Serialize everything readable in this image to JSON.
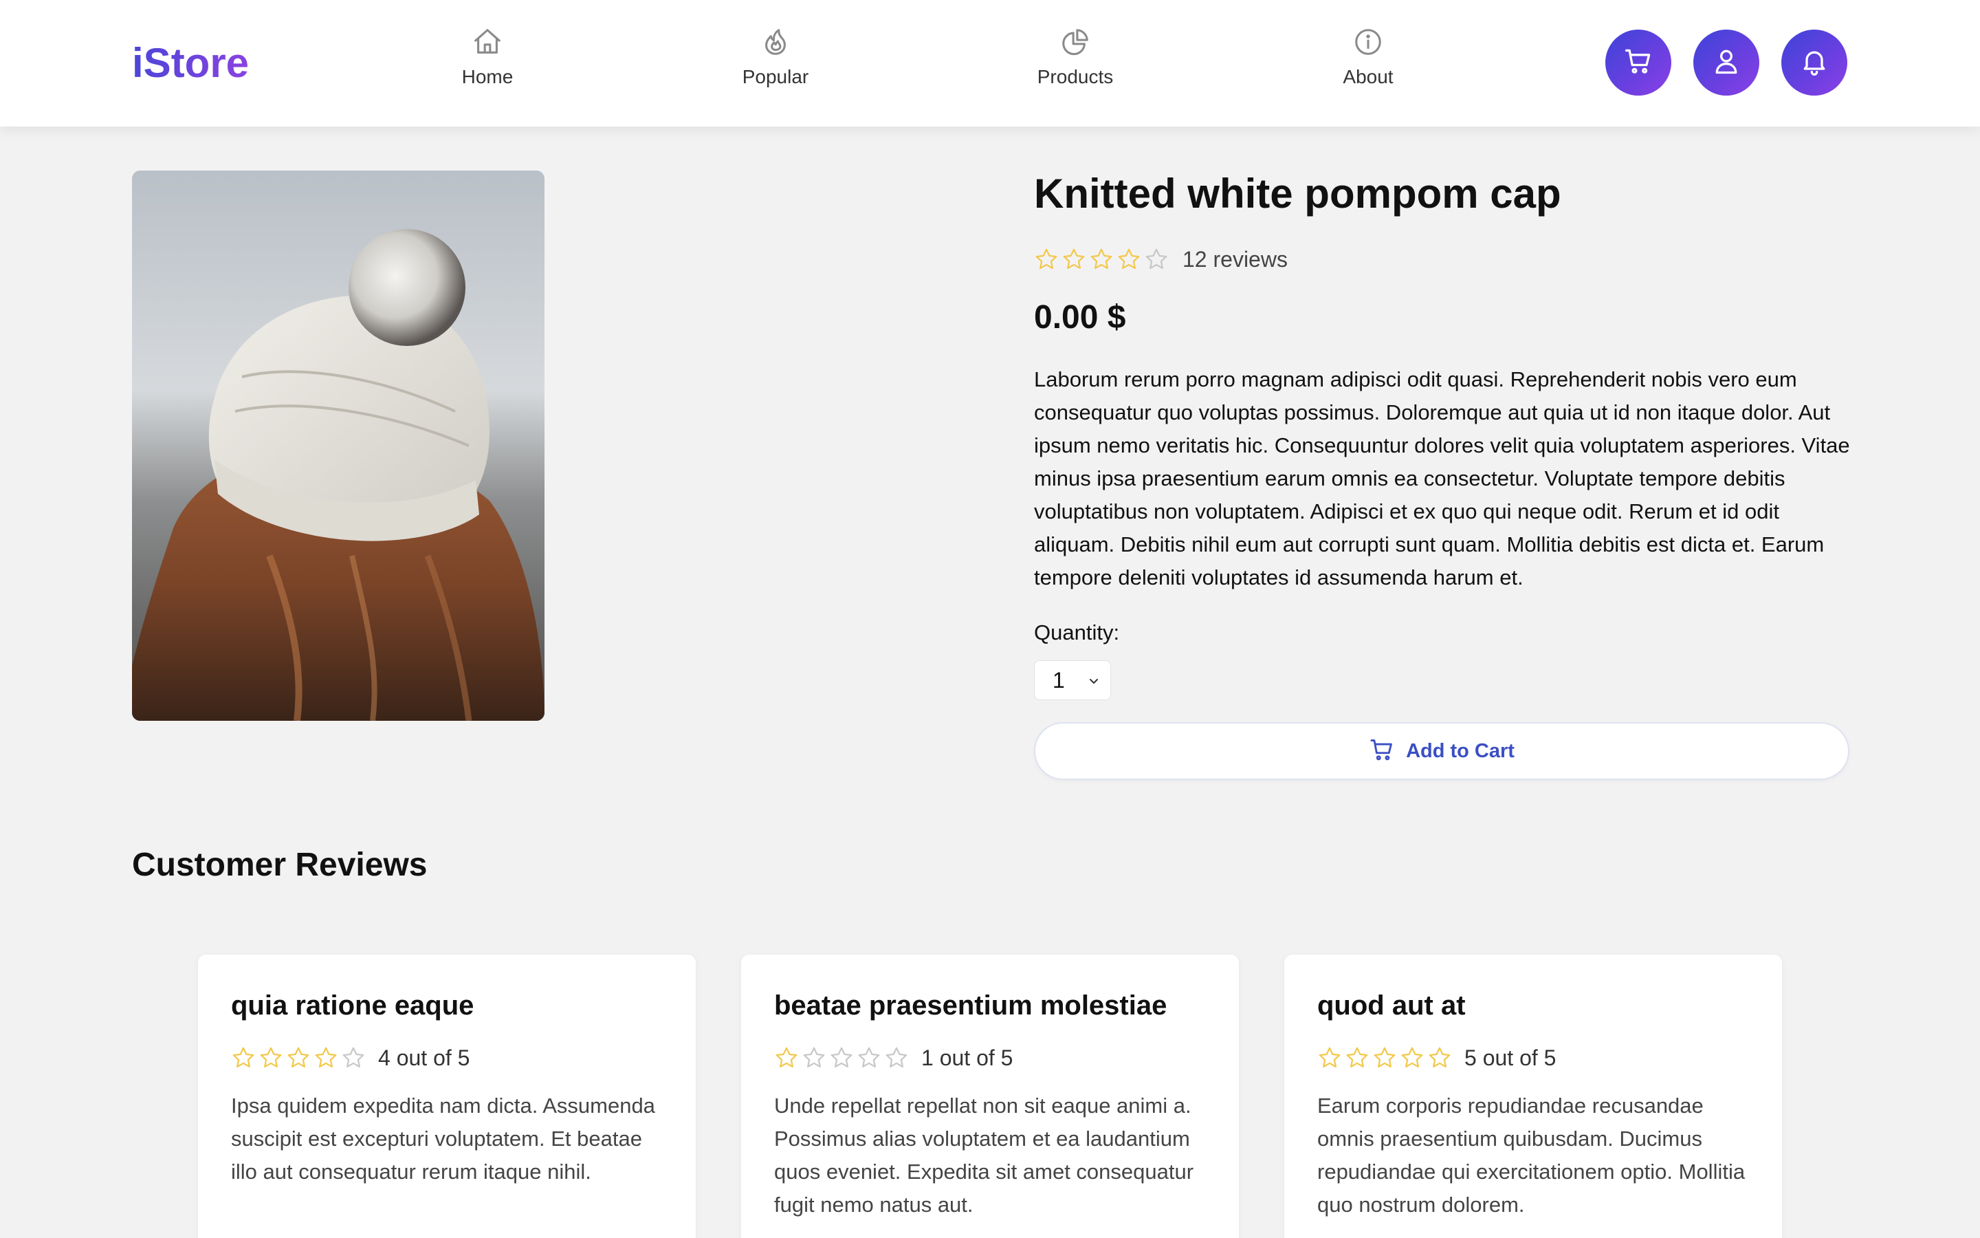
{
  "brand": {
    "name": "iStore",
    "gradient": [
      "#4c45d8",
      "#8a43e0"
    ]
  },
  "nav": [
    {
      "label": "Home",
      "icon": "home-icon"
    },
    {
      "label": "Popular",
      "icon": "flame-icon"
    },
    {
      "label": "Products",
      "icon": "pie-chart-icon"
    },
    {
      "label": "About",
      "icon": "info-icon"
    }
  ],
  "header_actions": [
    {
      "name": "cart",
      "icon": "cart-icon"
    },
    {
      "name": "account",
      "icon": "user-icon"
    },
    {
      "name": "notifications",
      "icon": "bell-icon"
    }
  ],
  "product": {
    "title": "Knitted white pompom cap",
    "rating": 4,
    "rating_max": 5,
    "reviews_label": "12 reviews",
    "price": "0.00 $",
    "description": "Laborum rerum porro magnam adipisci odit quasi. Reprehenderit nobis vero eum consequatur quo voluptas possimus. Doloremque aut quia ut id non itaque dolor. Aut ipsum nemo veritatis hic. Consequuntur dolores velit quia voluptatem asperiores. Vitae minus ipsa praesentium earum omnis ea consectetur. Voluptate tempore debitis voluptatibus non voluptatem. Adipisci et ex quo qui neque odit. Rerum et id odit aliquam. Debitis nihil eum aut corrupti sunt quam. Mollitia debitis est dicta et. Earum tempore deleniti voluptates id assumenda harum et.",
    "quantity_label": "Quantity:",
    "quantity_value": "1",
    "add_to_cart_label": "Add to Cart"
  },
  "reviews_section": {
    "heading": "Customer Reviews",
    "items": [
      {
        "title": "quia ratione eaque",
        "rating": 4,
        "rating_text": "4 out of 5",
        "body": "Ipsa quidem expedita nam dicta. Assumenda suscipit est excepturi voluptatem. Et beatae illo aut consequatur rerum itaque nihil."
      },
      {
        "title": "beatae praesentium molestiae",
        "rating": 1,
        "rating_text": "1 out of 5",
        "body": "Unde repellat repellat non sit eaque animi a. Possimus alias voluptatem et ea laudantium quos eveniet. Expedita sit amet consequatur fugit nemo natus aut."
      },
      {
        "title": "quod aut at",
        "rating": 5,
        "rating_text": "5 out of 5",
        "body": "Earum corporis repudiandae recusandae omnis praesentium quibusdam. Ducimus repudiandae qui exercitationem optio. Mollitia quo nostrum dolorem."
      }
    ]
  },
  "colors": {
    "accent": "#3d44d9",
    "accent_purple": "#8b40e6",
    "star_filled": "#f2c94c",
    "star_empty": "#c8c8c8",
    "add_to_cart_text": "#3b4fc4",
    "page_background": "#f3f2f3"
  }
}
